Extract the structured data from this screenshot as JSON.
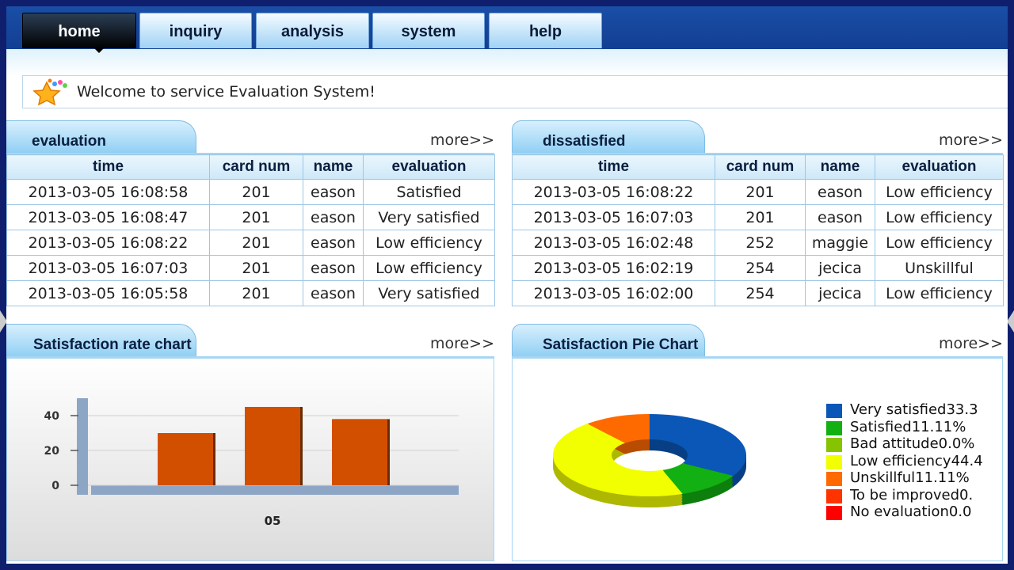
{
  "nav": {
    "tabs": [
      {
        "label": "home"
      },
      {
        "label": "inquiry"
      },
      {
        "label": "analysis"
      },
      {
        "label": "system"
      },
      {
        "label": "help"
      }
    ]
  },
  "welcome": {
    "text": "Welcome to service Evaluation System!"
  },
  "evaluation": {
    "title": "evaluation",
    "more": "more>>",
    "columns": [
      "time",
      "card num",
      "name",
      "evaluation"
    ],
    "rows": [
      [
        "2013-03-05 16:08:58",
        "201",
        "eason",
        "Satisfied"
      ],
      [
        "2013-03-05 16:08:47",
        "201",
        "eason",
        "Very satisfied"
      ],
      [
        "2013-03-05 16:08:22",
        "201",
        "eason",
        "Low efficiency"
      ],
      [
        "2013-03-05 16:07:03",
        "201",
        "eason",
        "Low efficiency"
      ],
      [
        "2013-03-05 16:05:58",
        "201",
        "eason",
        "Very satisfied"
      ]
    ]
  },
  "dissatisfied": {
    "title": "dissatisfied",
    "more": "more>>",
    "columns": [
      "time",
      "card num",
      "name",
      "evaluation"
    ],
    "rows": [
      [
        "2013-03-05 16:08:22",
        "201",
        "eason",
        "Low efficiency"
      ],
      [
        "2013-03-05 16:07:03",
        "201",
        "eason",
        "Low efficiency"
      ],
      [
        "2013-03-05 16:02:48",
        "252",
        "maggie",
        "Low efficiency"
      ],
      [
        "2013-03-05 16:02:19",
        "254",
        "jecica",
        "Unskillful"
      ],
      [
        "2013-03-05 16:02:00",
        "254",
        "jecica",
        "Low efficiency"
      ]
    ]
  },
  "rate_panel": {
    "title": "Satisfaction rate chart",
    "more": "more>>"
  },
  "pie_panel": {
    "title": "Satisfaction Pie Chart",
    "more": "more>>"
  },
  "chart_data": [
    {
      "type": "bar",
      "categories": [
        "05"
      ],
      "series": [
        {
          "values": [
            30
          ],
          "color": "#d24f00"
        },
        {
          "values": [
            45
          ],
          "color": "#d24f00"
        },
        {
          "values": [
            38
          ],
          "color": "#d24f00"
        }
      ],
      "yticks": [
        "40",
        "20",
        "0"
      ],
      "ylim": [
        0,
        50
      ],
      "grid": true
    },
    {
      "type": "pie",
      "slices": [
        {
          "label": "Very satisfied33.3",
          "value": 33.33,
          "color": "#0b57b7"
        },
        {
          "label": "Satisfied11.11%",
          "value": 11.11,
          "color": "#12b012"
        },
        {
          "label": "Bad attitude0.0%",
          "value": 0.0,
          "color": "#86c300"
        },
        {
          "label": "Low efficiency44.4",
          "value": 44.44,
          "color": "#f2ff00"
        },
        {
          "label": "Unskillful11.11%",
          "value": 11.11,
          "color": "#ff6a00"
        },
        {
          "label": "To be improved0.",
          "value": 0.0,
          "color": "#ff3300"
        },
        {
          "label": "No evaluation0.0",
          "value": 0.0,
          "color": "#ff0000"
        }
      ],
      "legend": "right"
    }
  ]
}
